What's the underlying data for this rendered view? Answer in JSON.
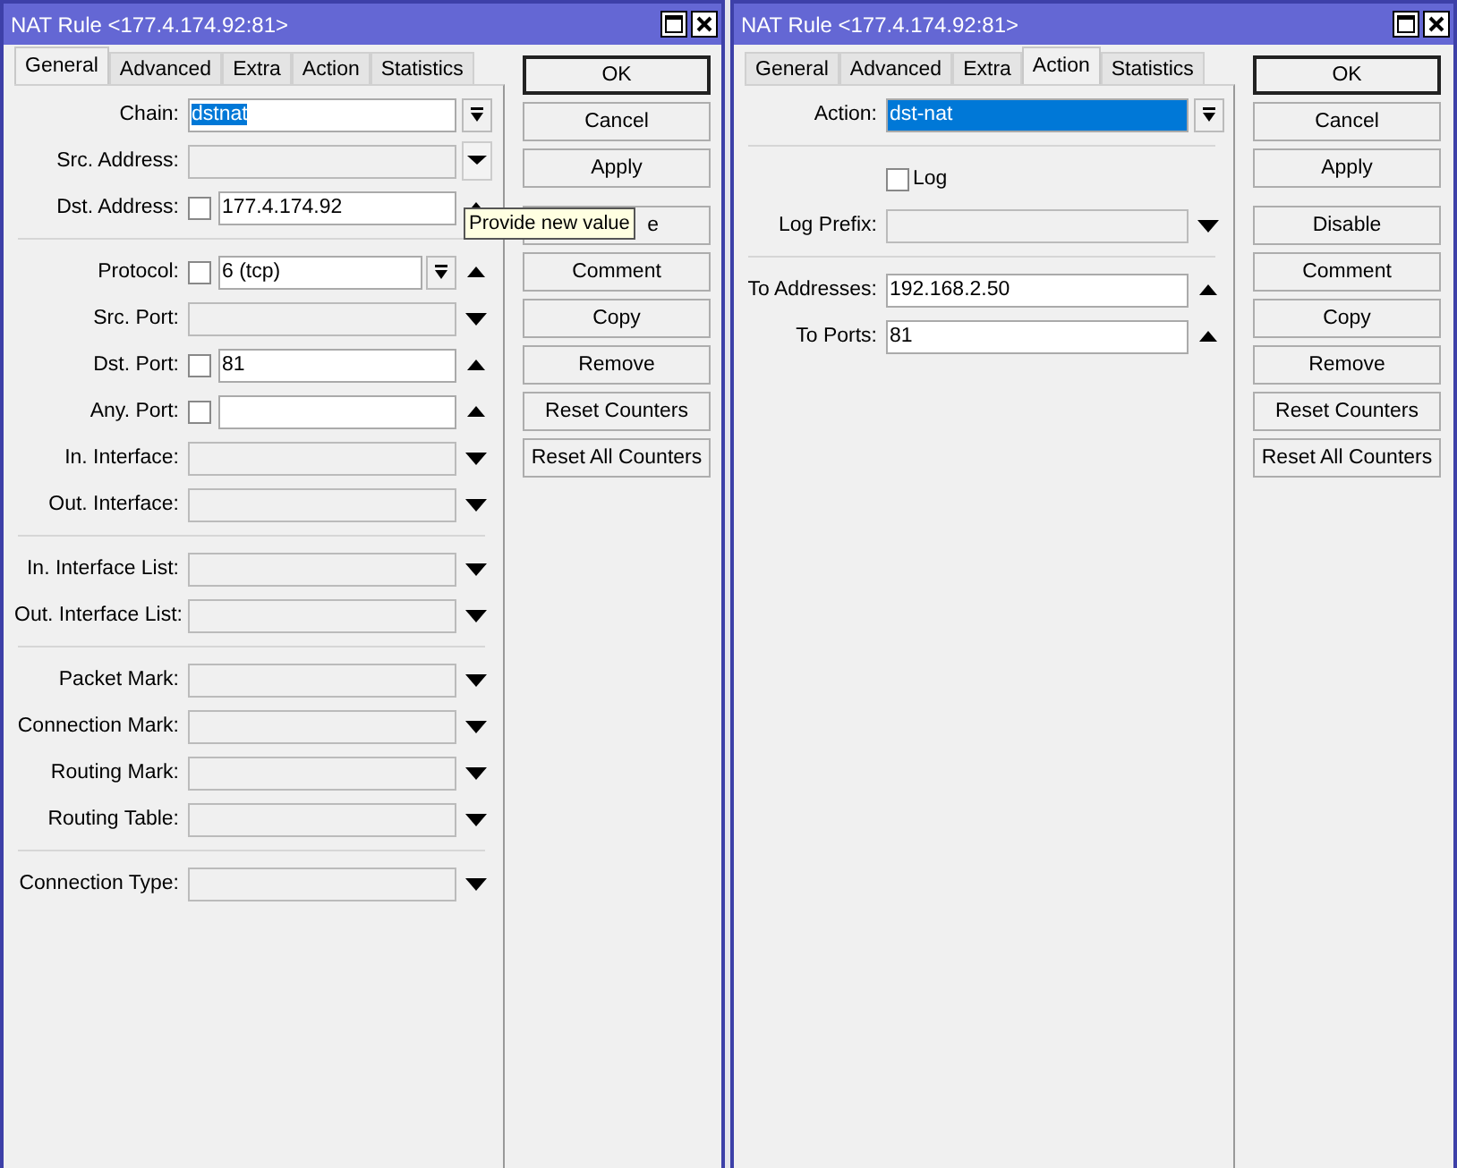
{
  "windows": [
    {
      "title": "NAT Rule <177.4.174.92:81>",
      "tabs": [
        {
          "label": "General",
          "selected": true
        },
        {
          "label": "Advanced",
          "selected": false
        },
        {
          "label": "Extra",
          "selected": false
        },
        {
          "label": "Action",
          "selected": false
        },
        {
          "label": "Statistics",
          "selected": false
        }
      ],
      "groups": [
        [
          {
            "kind": "combo",
            "label": "Chain:",
            "value": "dstnat",
            "text_selected": true,
            "disabled": false
          },
          {
            "kind": "menu",
            "label": "Src. Address:",
            "disabled": true
          },
          {
            "kind": "updown",
            "label": "Dst. Address:",
            "negated": false,
            "value": "177.4.174.92",
            "disabled": false
          }
        ],
        [
          {
            "kind": "updown",
            "label": "Protocol:",
            "negated": false,
            "value": "6 (tcp)",
            "disabled": false,
            "inner_combo": true
          },
          {
            "kind": "dropdown",
            "label": "Src. Port:",
            "disabled": true
          },
          {
            "kind": "updown",
            "label": "Dst. Port:",
            "negated": false,
            "value": "81",
            "disabled": false
          },
          {
            "kind": "updown",
            "label": "Any. Port:",
            "negated": false,
            "disabled": false
          },
          {
            "kind": "dropdown",
            "label": "In. Interface:",
            "disabled": true
          },
          {
            "kind": "dropdown",
            "label": "Out. Interface:",
            "disabled": true
          }
        ],
        [
          {
            "kind": "dropdown",
            "label": "In. Interface List:",
            "disabled": true
          },
          {
            "kind": "dropdown",
            "label": "Out. Interface List:",
            "disabled": true
          }
        ],
        [
          {
            "kind": "dropdown",
            "label": "Packet Mark:",
            "disabled": true
          },
          {
            "kind": "dropdown",
            "label": "Connection Mark:",
            "disabled": true
          },
          {
            "kind": "dropdown",
            "label": "Routing Mark:",
            "disabled": true
          },
          {
            "kind": "dropdown",
            "label": "Routing Table:",
            "disabled": true
          }
        ],
        [
          {
            "kind": "dropdown",
            "label": "Connection Type:",
            "disabled": true
          }
        ]
      ],
      "buttons": [
        {
          "label": "OK",
          "default": true,
          "covered": false
        },
        {
          "label": "Cancel",
          "default": false,
          "covered": false
        },
        {
          "label": "Apply",
          "default": false,
          "covered": false
        },
        {
          "label": "e",
          "default": false,
          "covered": true
        },
        {
          "label": "Comment",
          "default": false,
          "covered": false
        },
        {
          "label": "Copy",
          "default": false,
          "covered": false
        },
        {
          "label": "Remove",
          "default": false,
          "covered": false
        },
        {
          "label": "Reset Counters",
          "default": false,
          "covered": false
        },
        {
          "label": "Reset All Counters",
          "default": false,
          "covered": false
        }
      ],
      "tooltip": "Provide new value"
    },
    {
      "title": "NAT Rule <177.4.174.92:81>",
      "tabs": [
        {
          "label": "General",
          "selected": false
        },
        {
          "label": "Advanced",
          "selected": false
        },
        {
          "label": "Extra",
          "selected": false
        },
        {
          "label": "Action",
          "selected": true
        },
        {
          "label": "Statistics",
          "selected": false
        }
      ],
      "groups": [
        [
          {
            "kind": "combo",
            "label": "Action:",
            "value": "dst-nat",
            "focused": true,
            "disabled": false
          }
        ],
        [
          {
            "kind": "checkbox",
            "label": "Log",
            "checked": false
          },
          {
            "kind": "dropdown",
            "label": "Log Prefix:",
            "disabled": true
          }
        ],
        [
          {
            "kind": "updown",
            "label": "To Addresses:",
            "value": "192.168.2.50",
            "disabled": false
          },
          {
            "kind": "updown",
            "label": "To Ports:",
            "value": "81",
            "disabled": false
          }
        ]
      ],
      "buttons": [
        {
          "label": "OK",
          "default": true,
          "covered": false
        },
        {
          "label": "Cancel",
          "default": false,
          "covered": false
        },
        {
          "label": "Apply",
          "default": false,
          "covered": false
        },
        {
          "label": "Disable",
          "default": false,
          "covered": false
        },
        {
          "label": "Comment",
          "default": false,
          "covered": false
        },
        {
          "label": "Copy",
          "default": false,
          "covered": false
        },
        {
          "label": "Remove",
          "default": false,
          "covered": false
        },
        {
          "label": "Reset Counters",
          "default": false,
          "covered": false
        },
        {
          "label": "Reset All Counters",
          "default": false,
          "covered": false
        }
      ]
    }
  ]
}
